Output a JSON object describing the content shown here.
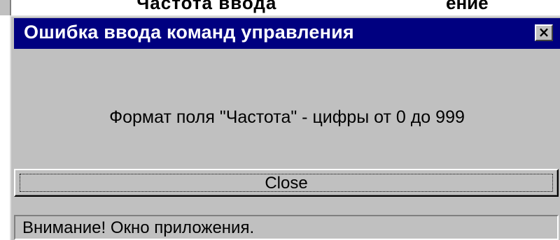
{
  "background_window": {
    "partial_text_left": "Частота ввода",
    "partial_text_right": "ение"
  },
  "dialog": {
    "title": "Ошибка ввода команд управления",
    "close_icon": "close-icon",
    "message": "Формат поля \"Частота\" - цифры от 0 до 999",
    "button_label": "Close",
    "status_text": "Внимание! Окно приложения."
  },
  "colors": {
    "titlebar": "#000080",
    "face": "#c0c0c0",
    "title_text": "#ffffff"
  }
}
